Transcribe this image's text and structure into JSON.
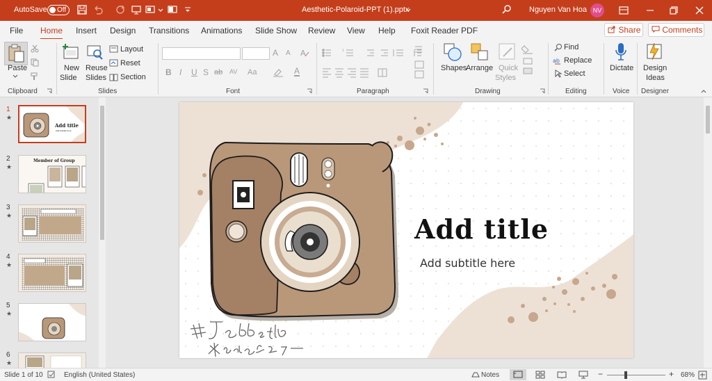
{
  "titlebar": {
    "autosave_label": "AutoSave",
    "autosave_state": "Off",
    "filename": "Aesthetic-Polaroid-PPT (1).pptx",
    "user_name": "Nguyen Van Hoa",
    "user_initials": "NV"
  },
  "menu": {
    "tabs": [
      "File",
      "Home",
      "Insert",
      "Design",
      "Transitions",
      "Animations",
      "Slide Show",
      "Review",
      "View",
      "Help",
      "Foxit Reader PDF"
    ],
    "active": "Home",
    "share_label": "Share",
    "comments_label": "Comments"
  },
  "ribbon": {
    "clipboard": {
      "group": "Clipboard",
      "paste": "Paste"
    },
    "slides": {
      "group": "Slides",
      "new_slide_1": "New",
      "new_slide_2": "Slide",
      "reuse_1": "Reuse",
      "reuse_2": "Slides",
      "layout": "Layout",
      "reset": "Reset",
      "section": "Section"
    },
    "font": {
      "group": "Font",
      "bold": "B",
      "italic": "I",
      "underline": "U",
      "shadow": "S",
      "strike": "ab",
      "spacing": "AV",
      "case": "Aa",
      "grow": "A",
      "shrink": "A",
      "font_color": "A"
    },
    "paragraph": {
      "group": "Paragraph"
    },
    "drawing": {
      "group": "Drawing",
      "shapes": "Shapes",
      "arrange": "Arrange",
      "quick_1": "Quick",
      "quick_2": "Styles"
    },
    "editing": {
      "group": "Editing",
      "find": "Find",
      "replace": "Replace",
      "select": "Select"
    },
    "voice": {
      "group": "Voice",
      "dictate": "Dictate"
    },
    "designer": {
      "group": "Designer",
      "ideas_1": "Design",
      "ideas_2": "Ideas"
    }
  },
  "thumbnails": [
    {
      "number": "1",
      "title": "Add title",
      "subtitle": "Add subtitle here"
    },
    {
      "number": "2",
      "title": "Member of Group"
    },
    {
      "number": "3",
      "title": ""
    },
    {
      "number": "4",
      "title": ""
    },
    {
      "number": "5",
      "title": ""
    },
    {
      "number": "6",
      "title": ""
    }
  ],
  "slide": {
    "title": "Add title",
    "subtitle": "Add subtitle here"
  },
  "status": {
    "slide_info": "Slide 1 of 10",
    "language": "English (United States)",
    "notes": "Notes",
    "zoom": "68%"
  },
  "colors": {
    "accent": "#c43e1c",
    "camera_body": "#b9987a",
    "camera_dark": "#a48064",
    "blob": "#ede1d6"
  }
}
